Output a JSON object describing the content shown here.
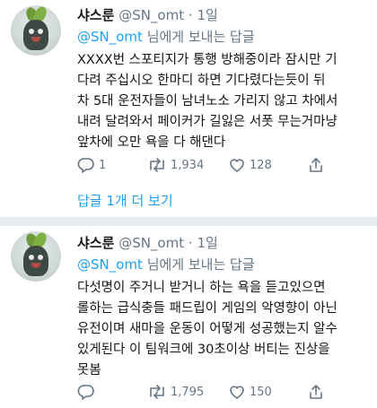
{
  "tweets": [
    {
      "name": "샤스룬",
      "handle": "@SN_omt",
      "dot": "·",
      "time": "1일",
      "reply_mention": "@SN_omt",
      "reply_suffix": "님에게 보내는 답글",
      "lines": [
        "XXXX번 스포티지가 통행 방해중이라 잠시만 기",
        "다려 주십시오 한마디 하면 기다렸다는듯이 뒤",
        "차 5대 운전자들이 남녀노소 가리지 않고 차에서",
        "내려 달려와서 페이커가 길잃은 서폿 무는거마냥",
        "앞차에 오만 욕을 다 해댄다"
      ],
      "replies": "1",
      "retweets": "1,934",
      "likes": "128",
      "show_replies": "답글 1개 더 보기"
    },
    {
      "name": "샤스룬",
      "handle": "@SN_omt",
      "dot": "·",
      "time": "1일",
      "reply_mention": "@SN_omt",
      "reply_suffix": "님에게 보내는 답글",
      "lines": [
        "다섯명이 주거니 받거니 하는 욕을 듣고있으면",
        "롤하는 급식충들 패드립이 게임의 악영향이 아닌",
        "유전이며 새마을 운동이 어떻게 성공했는지 알수",
        "있게된다 이 팀워크에 30초이상 버티는 진상을",
        "못봄"
      ],
      "replies": "",
      "retweets": "1,795",
      "likes": "150"
    }
  ],
  "icons": {
    "reply": "reply-icon",
    "retweet": "retweet-icon",
    "like": "heart-icon",
    "share": "share-icon"
  },
  "colors": {
    "link": "#1da1f2",
    "muted": "#657786",
    "text": "#14171a",
    "divider": "#e6ecf0"
  }
}
